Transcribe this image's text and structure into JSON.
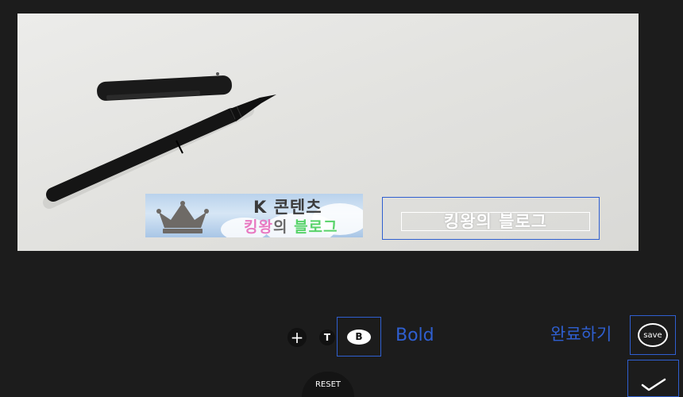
{
  "canvas": {
    "sticker": {
      "line1": "K 콘텐츠",
      "line2_part1": "킹왕",
      "line2_part2": "의 ",
      "line2_part3": "블로그"
    },
    "text_box": {
      "text": "킹왕의 블로그"
    }
  },
  "toolbar": {
    "plus_label": "+",
    "t_label": "T",
    "b_label": "B",
    "bold_label": "Bold",
    "done_label": "완료하기",
    "save_label": "save",
    "reset_label": "RESET"
  },
  "colors": {
    "background": "#1c1c1c",
    "accent_blue": "#2f5fd0",
    "sticker_pink": "#e879c1",
    "sticker_green": "#58d36a"
  }
}
